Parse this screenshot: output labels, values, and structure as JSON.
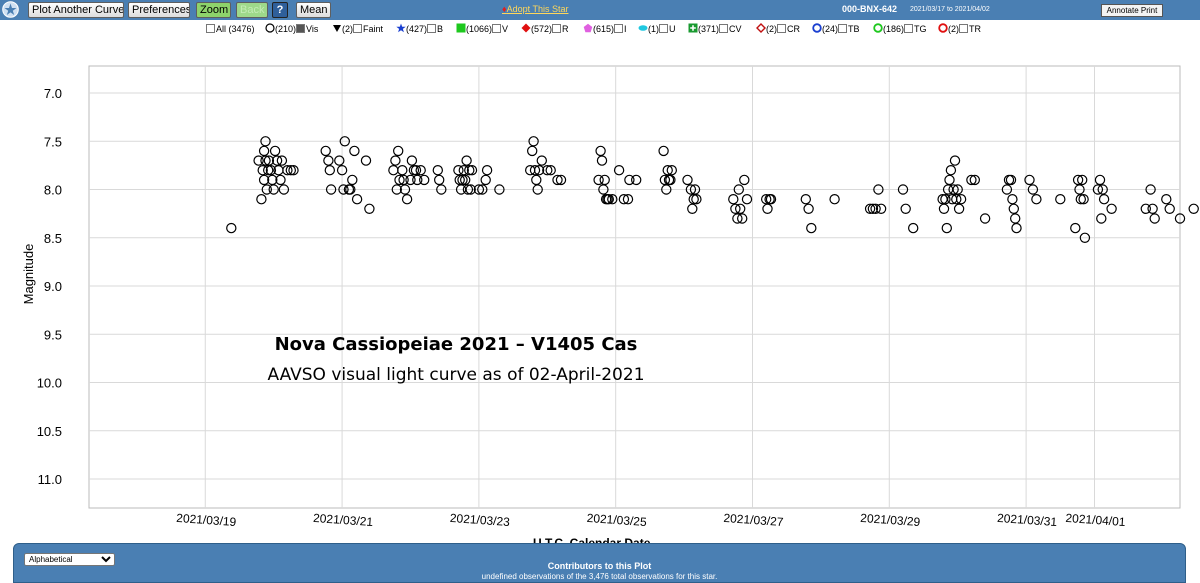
{
  "toolbar": {
    "buttons": {
      "plot_another": "Plot Another Curve",
      "preferences": "Preferences",
      "zoom": "Zoom",
      "back": "Back",
      "help": "?",
      "mean": "Mean"
    },
    "adopt_label": "Adopt This Star",
    "star_id": "000-BNX-642",
    "date_range": "2021/03/17 to 2021/04/02",
    "annotate_label": "Annotate Print"
  },
  "legend": {
    "all": {
      "label": "All",
      "count": "(3476)",
      "checked": false
    },
    "items": [
      {
        "count": "(210)",
        "label": "Vis",
        "icon": "open-circle-icon",
        "color": "#000000",
        "checked": true
      },
      {
        "count": "(2)",
        "label": "Faint",
        "icon": "down-triangle-icon",
        "color": "#000000",
        "checked": false
      },
      {
        "count": "(427)",
        "label": "B",
        "icon": "star-icon",
        "color": "#1a3fd0",
        "checked": false
      },
      {
        "count": "(1066)",
        "label": "V",
        "icon": "square-icon",
        "color": "#1ec81e",
        "checked": false
      },
      {
        "count": "(572)",
        "label": "R",
        "icon": "diamond-icon",
        "color": "#e01010",
        "checked": false
      },
      {
        "count": "(615)",
        "label": "I",
        "icon": "pentagon-icon",
        "color": "#e060e0",
        "checked": false
      },
      {
        "count": "(1)",
        "label": "U",
        "icon": "ellipse-icon",
        "color": "#20c8e0",
        "checked": false
      },
      {
        "count": "(371)",
        "label": "CV",
        "icon": "plus-square-icon",
        "color": "#1a9a30",
        "checked": false
      },
      {
        "count": "(2)",
        "label": "CR",
        "icon": "open-diamond-icon",
        "color": "#c01010",
        "checked": false
      },
      {
        "count": "(24)",
        "label": "TB",
        "icon": "ring-icon",
        "color": "#1a3fd0",
        "checked": false
      },
      {
        "count": "(186)",
        "label": "TG",
        "icon": "ring-icon",
        "color": "#1ec81e",
        "checked": false
      },
      {
        "count": "(2)",
        "label": "TR",
        "icon": "ring-icon",
        "color": "#e01010",
        "checked": false
      }
    ]
  },
  "annotation": {
    "title": "Nova Cassiopeiae 2021 – V1405 Cas",
    "subtitle": "AAVSO visual light curve as of 02-April-2021"
  },
  "chart_data": {
    "type": "scatter",
    "xlabel": "U.T.C. Calendar Date",
    "ylabel": "Magnitude",
    "x_ticks": [
      "2021/03/19",
      "2021/03/21",
      "2021/03/23",
      "2021/03/25",
      "2021/03/27",
      "2021/03/29",
      "2021/03/31",
      "2021/04/01"
    ],
    "x_tick_days": [
      19,
      21,
      23,
      25,
      27,
      29,
      31,
      32
    ],
    "x_range_days": [
      17.3,
      33.25
    ],
    "x_unit_note": "days of March 2021 (UTC)",
    "y_ticks": [
      "7.0",
      "7.5",
      "8.0",
      "8.5",
      "9.0",
      "9.5",
      "10.0",
      "10.5",
      "11.0"
    ],
    "ylim": [
      6.72,
      11.3
    ],
    "y_inverted": true,
    "grid": true,
    "series": [
      {
        "name": "Vis",
        "marker": "open-circle",
        "color": "#000000",
        "points": [
          [
            19.38,
            8.4
          ],
          [
            19.78,
            7.7
          ],
          [
            19.82,
            8.1
          ],
          [
            19.84,
            7.8
          ],
          [
            19.86,
            7.9
          ],
          [
            19.86,
            7.6
          ],
          [
            19.88,
            7.7
          ],
          [
            19.88,
            7.5
          ],
          [
            19.9,
            8.0
          ],
          [
            19.92,
            7.8
          ],
          [
            19.93,
            7.7
          ],
          [
            19.96,
            7.8
          ],
          [
            19.98,
            7.9
          ],
          [
            20.0,
            8.0
          ],
          [
            20.02,
            7.6
          ],
          [
            20.05,
            7.7
          ],
          [
            20.07,
            7.8
          ],
          [
            20.1,
            7.9
          ],
          [
            20.12,
            7.7
          ],
          [
            20.15,
            8.0
          ],
          [
            20.2,
            7.8
          ],
          [
            20.25,
            7.8
          ],
          [
            20.29,
            7.8
          ],
          [
            20.76,
            7.6
          ],
          [
            20.8,
            7.7
          ],
          [
            20.82,
            7.8
          ],
          [
            20.84,
            8.0
          ],
          [
            20.96,
            7.7
          ],
          [
            21.0,
            7.8
          ],
          [
            21.02,
            8.0
          ],
          [
            21.04,
            7.5
          ],
          [
            21.1,
            8.0
          ],
          [
            21.12,
            8.0
          ],
          [
            21.15,
            7.9
          ],
          [
            21.18,
            7.6
          ],
          [
            21.22,
            8.1
          ],
          [
            21.35,
            7.7
          ],
          [
            21.4,
            8.2
          ],
          [
            21.75,
            7.8
          ],
          [
            21.78,
            7.7
          ],
          [
            21.8,
            8.0
          ],
          [
            21.82,
            7.6
          ],
          [
            21.84,
            7.9
          ],
          [
            21.88,
            7.8
          ],
          [
            21.9,
            7.9
          ],
          [
            21.92,
            8.0
          ],
          [
            21.95,
            8.1
          ],
          [
            22.0,
            7.9
          ],
          [
            22.02,
            7.7
          ],
          [
            22.05,
            7.8
          ],
          [
            22.08,
            7.8
          ],
          [
            22.1,
            7.9
          ],
          [
            22.15,
            7.8
          ],
          [
            22.2,
            7.9
          ],
          [
            22.4,
            7.8
          ],
          [
            22.42,
            7.9
          ],
          [
            22.45,
            8.0
          ],
          [
            22.7,
            7.8
          ],
          [
            22.72,
            7.9
          ],
          [
            22.74,
            8.0
          ],
          [
            22.76,
            7.9
          ],
          [
            22.78,
            7.8
          ],
          [
            22.8,
            7.9
          ],
          [
            22.82,
            7.7
          ],
          [
            22.84,
            8.0
          ],
          [
            22.86,
            7.8
          ],
          [
            22.88,
            8.0
          ],
          [
            22.9,
            7.8
          ],
          [
            23.0,
            8.0
          ],
          [
            23.05,
            8.0
          ],
          [
            23.1,
            7.9
          ],
          [
            23.12,
            7.8
          ],
          [
            23.3,
            8.0
          ],
          [
            23.75,
            7.8
          ],
          [
            23.78,
            7.6
          ],
          [
            23.8,
            7.5
          ],
          [
            23.82,
            7.8
          ],
          [
            23.84,
            7.9
          ],
          [
            23.86,
            8.0
          ],
          [
            23.88,
            7.8
          ],
          [
            23.92,
            7.7
          ],
          [
            24.0,
            7.8
          ],
          [
            24.05,
            7.8
          ],
          [
            24.15,
            7.9
          ],
          [
            24.2,
            7.9
          ],
          [
            24.75,
            7.9
          ],
          [
            24.78,
            7.6
          ],
          [
            24.8,
            7.7
          ],
          [
            24.82,
            8.0
          ],
          [
            24.84,
            7.9
          ],
          [
            24.86,
            8.1
          ],
          [
            24.88,
            8.1
          ],
          [
            24.9,
            8.1
          ],
          [
            24.95,
            8.1
          ],
          [
            25.05,
            7.8
          ],
          [
            25.12,
            8.1
          ],
          [
            25.18,
            8.1
          ],
          [
            25.2,
            7.9
          ],
          [
            25.3,
            7.9
          ],
          [
            25.7,
            7.6
          ],
          [
            25.72,
            7.9
          ],
          [
            25.74,
            8.0
          ],
          [
            25.76,
            7.8
          ],
          [
            25.78,
            7.9
          ],
          [
            25.8,
            7.9
          ],
          [
            25.82,
            7.8
          ],
          [
            26.05,
            7.9
          ],
          [
            26.1,
            8.0
          ],
          [
            26.12,
            8.2
          ],
          [
            26.14,
            8.1
          ],
          [
            26.16,
            8.0
          ],
          [
            26.18,
            8.1
          ],
          [
            26.72,
            8.1
          ],
          [
            26.75,
            8.2
          ],
          [
            26.78,
            8.3
          ],
          [
            26.8,
            8.0
          ],
          [
            26.82,
            8.2
          ],
          [
            26.85,
            8.3
          ],
          [
            26.88,
            7.9
          ],
          [
            26.92,
            8.1
          ],
          [
            27.2,
            8.1
          ],
          [
            27.22,
            8.2
          ],
          [
            27.25,
            8.1
          ],
          [
            27.27,
            8.1
          ],
          [
            27.78,
            8.1
          ],
          [
            27.82,
            8.2
          ],
          [
            27.86,
            8.4
          ],
          [
            28.2,
            8.1
          ],
          [
            28.72,
            8.2
          ],
          [
            28.76,
            8.2
          ],
          [
            28.8,
            8.2
          ],
          [
            28.84,
            8.0
          ],
          [
            28.88,
            8.2
          ],
          [
            29.2,
            8.0
          ],
          [
            29.24,
            8.2
          ],
          [
            29.35,
            8.4
          ],
          [
            29.78,
            8.1
          ],
          [
            29.8,
            8.2
          ],
          [
            29.82,
            8.1
          ],
          [
            29.84,
            8.4
          ],
          [
            29.86,
            8.0
          ],
          [
            29.88,
            7.9
          ],
          [
            29.9,
            7.8
          ],
          [
            29.92,
            8.1
          ],
          [
            29.94,
            8.0
          ],
          [
            29.96,
            7.7
          ],
          [
            29.98,
            8.1
          ],
          [
            30.0,
            8.0
          ],
          [
            30.02,
            8.2
          ],
          [
            30.05,
            8.1
          ],
          [
            30.2,
            7.9
          ],
          [
            30.25,
            7.9
          ],
          [
            30.4,
            8.3
          ],
          [
            30.72,
            8.0
          ],
          [
            30.75,
            7.9
          ],
          [
            30.78,
            7.9
          ],
          [
            30.8,
            8.1
          ],
          [
            30.82,
            8.2
          ],
          [
            30.84,
            8.3
          ],
          [
            30.86,
            8.4
          ],
          [
            31.05,
            7.9
          ],
          [
            31.1,
            8.0
          ],
          [
            31.15,
            8.1
          ],
          [
            31.5,
            8.1
          ],
          [
            31.72,
            8.4
          ],
          [
            31.76,
            7.9
          ],
          [
            31.78,
            8.0
          ],
          [
            31.8,
            8.1
          ],
          [
            31.82,
            7.9
          ],
          [
            31.84,
            8.1
          ],
          [
            31.86,
            8.5
          ],
          [
            32.05,
            8.0
          ],
          [
            32.08,
            7.9
          ],
          [
            32.1,
            8.3
          ],
          [
            32.12,
            8.0
          ],
          [
            32.14,
            8.1
          ],
          [
            32.25,
            8.2
          ],
          [
            32.75,
            8.2
          ],
          [
            32.82,
            8.0
          ],
          [
            32.85,
            8.2
          ],
          [
            32.88,
            8.3
          ],
          [
            33.05,
            8.1
          ],
          [
            33.1,
            8.2
          ],
          [
            33.25,
            8.3
          ],
          [
            33.45,
            8.2
          ]
        ]
      }
    ]
  },
  "bottom": {
    "sort_selected": "Alphabetical",
    "contributors_title": "Contributors to this Plot",
    "contributors_note": "undefined observations of the 3,476 total observations for this star."
  }
}
